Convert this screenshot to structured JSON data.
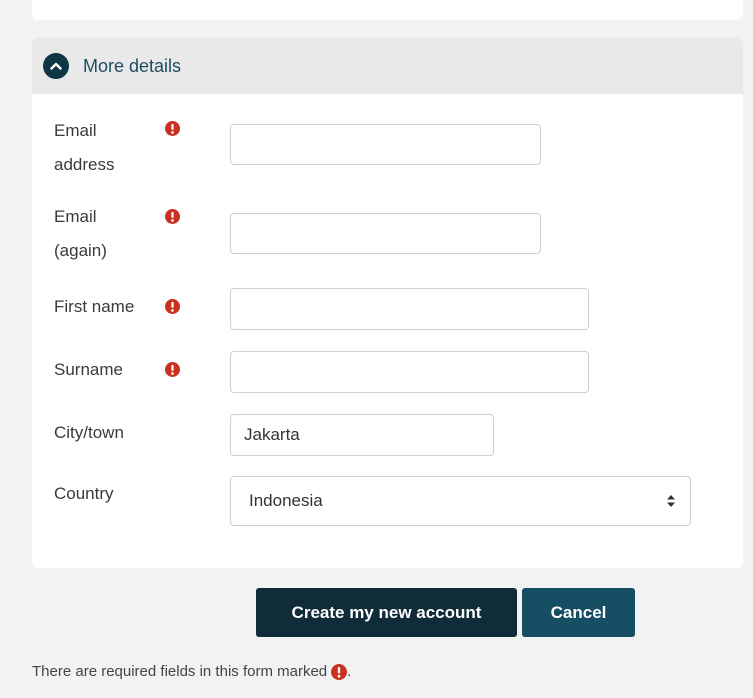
{
  "section": {
    "title": "More details"
  },
  "fields": {
    "email": {
      "label_line1": "Email",
      "label_line2": "address",
      "value": ""
    },
    "email_again": {
      "label_line1": "Email",
      "label_line2": "(again)",
      "value": ""
    },
    "firstname": {
      "label": "First name",
      "value": ""
    },
    "surname": {
      "label": "Surname",
      "value": ""
    },
    "city": {
      "label": "City/town",
      "value": "Jakarta"
    },
    "country": {
      "label": "Country",
      "value": "Indonesia"
    }
  },
  "buttons": {
    "create": "Create my new account",
    "cancel": "Cancel"
  },
  "footer": {
    "note": "There are required fields in this form marked",
    "note_end": "."
  },
  "icons": {
    "required": "exclamation-circle-icon",
    "collapse": "chevron-up-icon",
    "select_arrows": "sort-icon"
  },
  "colors": {
    "required": "#ca3120",
    "primary_button": "#0f2c38",
    "cancel_button": "#164f63",
    "header_icon": "#0f3645",
    "header_text": "#1d4d60"
  }
}
